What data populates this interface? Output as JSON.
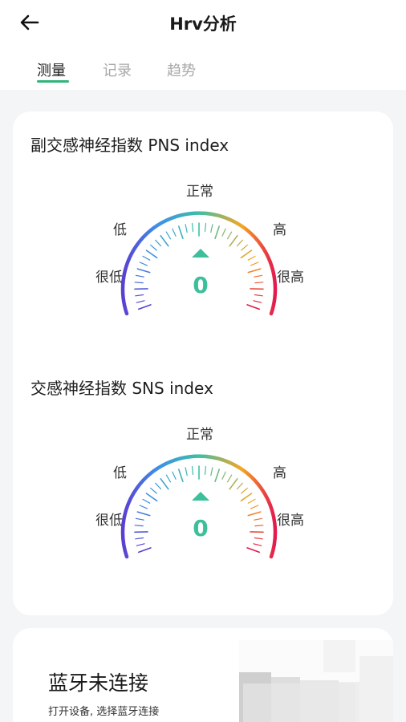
{
  "header": {
    "title": "Hrv分析",
    "back_icon": "arrow-left-icon"
  },
  "tabs": [
    {
      "label": "测量",
      "active": true
    },
    {
      "label": "记录",
      "active": false
    },
    {
      "label": "趋势",
      "active": false
    }
  ],
  "gauges": [
    {
      "title": "副交感神经指数 PNS index",
      "value": "0",
      "labels": {
        "normal": "正常",
        "low": "低",
        "very_low": "很低",
        "high": "高",
        "very_high": "很高"
      }
    },
    {
      "title": "交感神经指数 SNS index",
      "value": "0",
      "labels": {
        "normal": "正常",
        "low": "低",
        "very_low": "很低",
        "high": "高",
        "very_high": "很高"
      }
    }
  ],
  "bluetooth": {
    "title": "蓝牙未连接",
    "subtitle": "打开设备, 选择蓝牙连接"
  },
  "colors": {
    "accent": "#2fb57a",
    "value_text": "#3cbf9a",
    "gauge_violet": "#5b3fd0",
    "gauge_blue": "#3f8ee8",
    "gauge_teal": "#3cbfa6",
    "gauge_orange": "#f5a623",
    "gauge_red": "#e4194e"
  }
}
